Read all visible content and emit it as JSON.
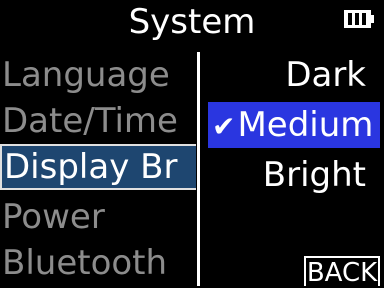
{
  "header": {
    "title": "System",
    "battery_icon": "battery-full-icon"
  },
  "menu": {
    "items": [
      {
        "label": "Language"
      },
      {
        "label": "Date/Time"
      },
      {
        "label": "Display Br",
        "selected": true
      },
      {
        "label": "Power"
      },
      {
        "label": "Bluetooth"
      }
    ]
  },
  "options": {
    "items": [
      {
        "label": "Dark"
      },
      {
        "label": "Medium",
        "selected": true,
        "check_icon": "✔"
      },
      {
        "label": "Bright"
      }
    ]
  },
  "back": {
    "label": "BACK"
  },
  "colors": {
    "menu_highlight": "#1e4670",
    "option_highlight": "#2a36e0",
    "inactive_text": "#8c8c8c"
  }
}
